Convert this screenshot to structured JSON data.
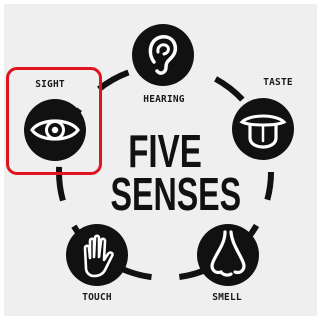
{
  "infographic": {
    "title_line_1": "FIVE",
    "title_line_2": "SENSES",
    "senses": {
      "hearing": {
        "label": "HEARING",
        "icon": "ear-icon"
      },
      "taste": {
        "label": "TASTE",
        "icon": "tongue-icon"
      },
      "sight": {
        "label": "SIGHT",
        "icon": "eye-icon"
      },
      "touch": {
        "label": "TOUCH",
        "icon": "hand-icon"
      },
      "smell": {
        "label": "SMELL",
        "icon": "nose-icon"
      }
    },
    "selected": "sight"
  },
  "colors": {
    "background": "#efefef",
    "ink": "#111111",
    "highlight": "#e0141e"
  }
}
